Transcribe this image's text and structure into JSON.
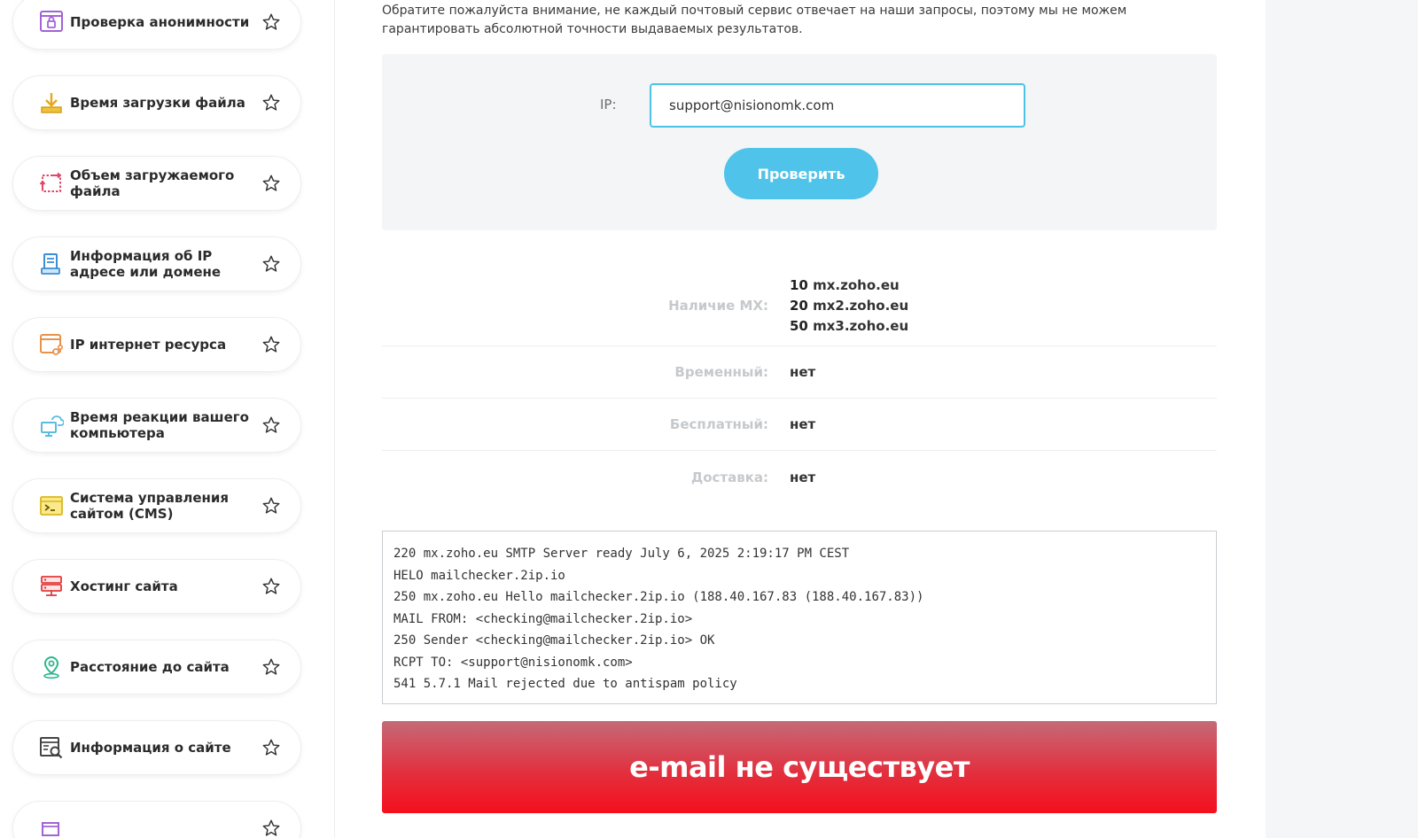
{
  "sidebar": {
    "items": [
      {
        "label": "Проверка анонимности",
        "icon": "anonymity-lock-icon"
      },
      {
        "label": "Время загрузки файла",
        "icon": "download-icon"
      },
      {
        "label": "Объем загружаемого файла",
        "icon": "upload-size-icon"
      },
      {
        "label": "Информация об IP адресе или домене",
        "icon": "ip-info-icon"
      },
      {
        "label": "IP интернет ресурса",
        "icon": "web-resource-icon"
      },
      {
        "label": "Время реакции вашего компьютера",
        "icon": "computer-reaction-icon"
      },
      {
        "label": "Система управления сайтом (CMS)",
        "icon": "cms-terminal-icon"
      },
      {
        "label": "Хостинг сайта",
        "icon": "hosting-server-icon"
      },
      {
        "label": "Расстояние до сайта",
        "icon": "location-pin-icon"
      },
      {
        "label": "Информация о сайте",
        "icon": "site-info-icon"
      }
    ]
  },
  "main": {
    "notice": "Обратите пожалуйста внимание, не каждый почтовый сервис отвечает на наши запросы, поэтому мы не можем гарантировать абсолютной точности выдаваемых результатов.",
    "form": {
      "ip_label": "IP:",
      "ip_value": "support@nisionomk.com",
      "submit_label": "Проверить"
    },
    "results": {
      "mx_label": "Наличие MX:",
      "mx_records": [
        {
          "priority": "10",
          "host": "mx.zoho.eu"
        },
        {
          "priority": "20",
          "host": "mx2.zoho.eu"
        },
        {
          "priority": "50",
          "host": "mx3.zoho.eu"
        }
      ],
      "temporary_label": "Временный:",
      "temporary_value": "нет",
      "free_label": "Бесплатный:",
      "free_value": "нет",
      "delivery_label": "Доставка:",
      "delivery_value": "нет"
    },
    "log": [
      "220 mx.zoho.eu SMTP Server ready July 6, 2025 2:19:17 PM CEST",
      "HELO mailchecker.2ip.io",
      "250 mx.zoho.eu Hello mailchecker.2ip.io (188.40.167.83 (188.40.167.83))",
      "MAIL FROM: <checking@mailchecker.2ip.io>",
      "250 Sender <checking@mailchecker.2ip.io> OK",
      "RCPT TO: <support@nisionomk.com>",
      "541 5.7.1 Mail rejected due to antispam policy"
    ],
    "status_text": "e-mail не существует"
  },
  "colors": {
    "accent": "#4fc3ea",
    "error_red": "#f50f1c"
  }
}
